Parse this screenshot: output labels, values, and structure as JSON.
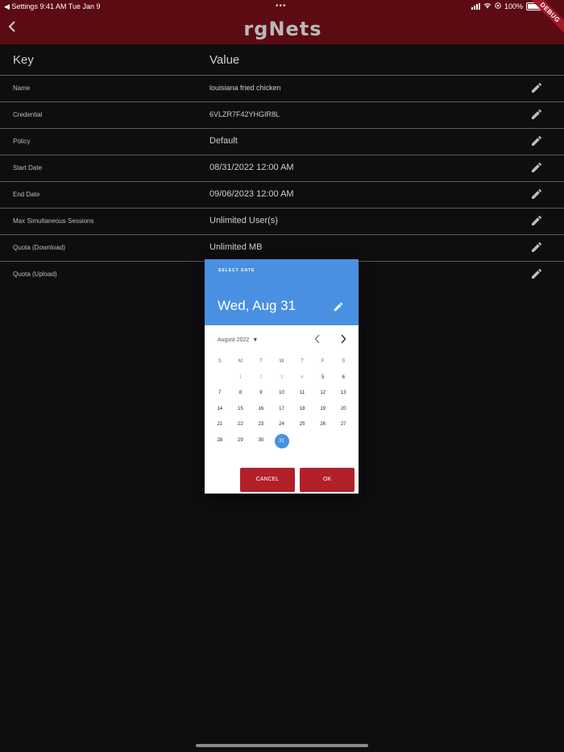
{
  "status_bar": {
    "left": "◀ Settings   9:41 AM   Tue Jan 9",
    "dots": "•••",
    "battery": "100%"
  },
  "app_bar": {
    "logo": "rgNets",
    "debug_ribbon": "DEBUG"
  },
  "table": {
    "key_header": "Key",
    "value_header": "Value",
    "rows": [
      {
        "key": "Name",
        "value": "louisiana fried chicken"
      },
      {
        "key": "Credential",
        "value": "6VLZR7F42YHGIR8L"
      },
      {
        "key": "Policy",
        "value": "Default"
      },
      {
        "key": "Start Date",
        "value": "08/31/2022 12:00 AM"
      },
      {
        "key": "End Date",
        "value": "09/06/2023 12:00 AM"
      },
      {
        "key": "Max Simultaneous Sessions",
        "value": "Unlimited User(s)"
      },
      {
        "key": "Quota (Download)",
        "value": "Unlimited MB"
      },
      {
        "key": "Quota (Upload)",
        "value": ""
      }
    ]
  },
  "date_picker": {
    "help_text": "SELECT DATE",
    "selected": "Wed, Aug 31",
    "month_label": "August 2022",
    "weekdays": [
      "S",
      "M",
      "T",
      "W",
      "T",
      "F",
      "S"
    ],
    "weeks": [
      [
        "",
        "1",
        "2",
        "3",
        "4",
        "5",
        "6"
      ],
      [
        "7",
        "8",
        "9",
        "10",
        "11",
        "12",
        "13"
      ],
      [
        "14",
        "15",
        "16",
        "17",
        "18",
        "19",
        "20"
      ],
      [
        "21",
        "22",
        "23",
        "24",
        "25",
        "26",
        "27"
      ],
      [
        "28",
        "29",
        "30",
        "31",
        "",
        "",
        ""
      ]
    ],
    "selected_day": "31",
    "cancel_label": "CANCEL",
    "ok_label": "OK",
    "accent_color": "#4a90e2",
    "button_color": "#b1202b"
  }
}
